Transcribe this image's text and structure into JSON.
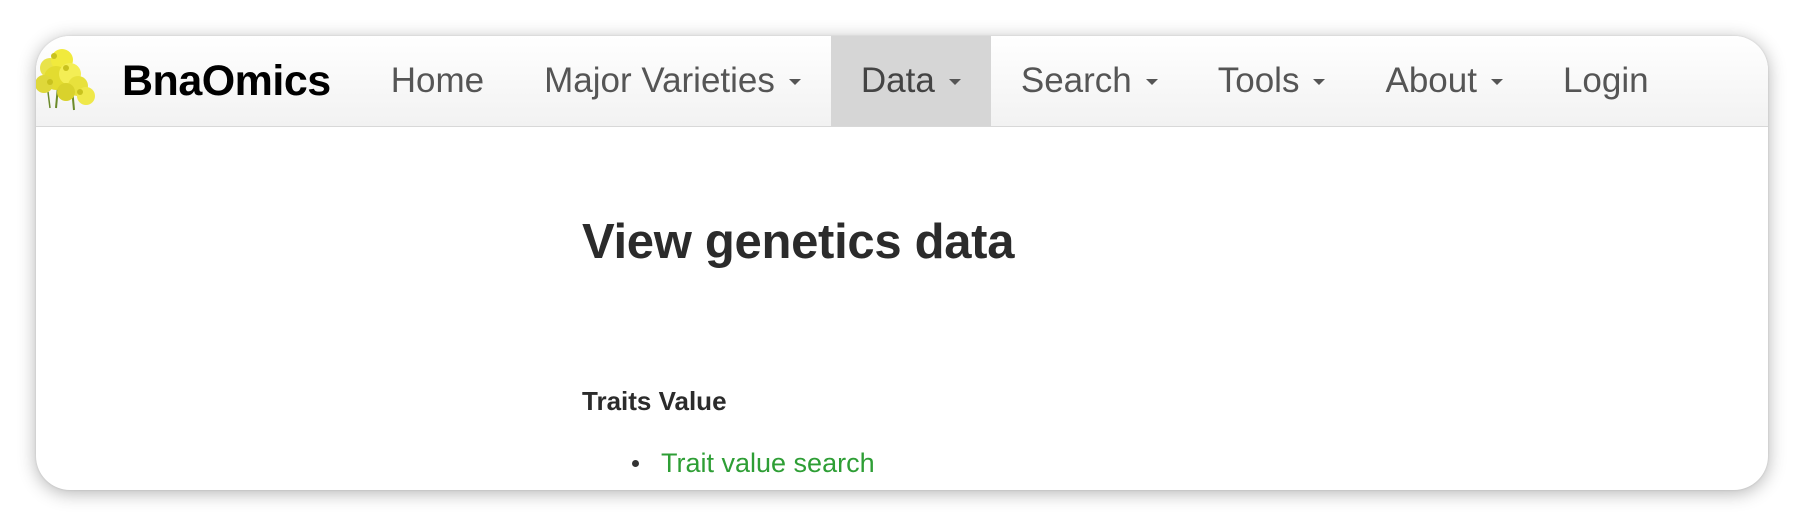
{
  "navbar": {
    "brand": "BnaOmics",
    "items": [
      {
        "label": "Home",
        "dropdown": false
      },
      {
        "label": "Major Varieties",
        "dropdown": true
      },
      {
        "label": "Data",
        "dropdown": true,
        "active": true
      },
      {
        "label": "Search",
        "dropdown": true
      },
      {
        "label": "Tools",
        "dropdown": true
      },
      {
        "label": "About",
        "dropdown": true
      },
      {
        "label": "Login",
        "dropdown": false
      }
    ]
  },
  "main": {
    "title": "View genetics data",
    "section": "Traits Value",
    "links": [
      "Trait value search"
    ]
  },
  "colors": {
    "link": "#2e9e35",
    "active_tab": "#d6d6d6",
    "nav_text": "#555555"
  },
  "icons": {
    "logo": "rapeseed-flower-logo",
    "caret": "caret-down-icon"
  }
}
